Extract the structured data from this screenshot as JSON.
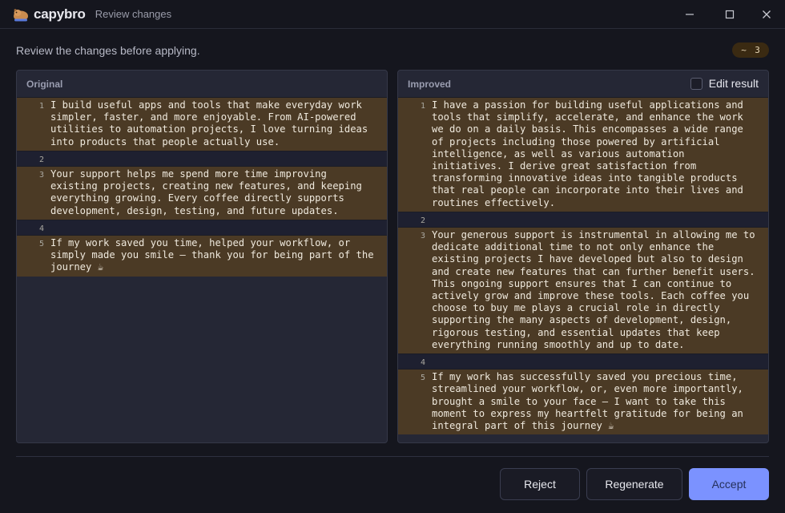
{
  "app": {
    "name": "capybro",
    "window_title": "Review changes",
    "logo_icon": "capybara-icon"
  },
  "subtitle": "Review the changes before applying.",
  "badge": {
    "symbol": "~",
    "count": "3"
  },
  "original": {
    "title": "Original",
    "lines": [
      {
        "num": "1",
        "text": "I build useful apps and tools that make everyday work simpler, faster, and more enjoyable. From AI-powered utilities to automation projects, I love turning ideas into products that people actually use.",
        "changed": true
      },
      {
        "num": "2",
        "text": "",
        "changed": false
      },
      {
        "num": "3",
        "text": "Your support helps me spend more time improving existing projects, creating new features, and keeping everything growing. Every coffee directly supports development, design, testing, and future updates.",
        "changed": true
      },
      {
        "num": "4",
        "text": "",
        "changed": false
      },
      {
        "num": "5",
        "text": "If my work saved you time, helped your workflow, or simply made you smile — thank you for being part of the journey ☕",
        "changed": true
      }
    ]
  },
  "improved": {
    "title": "Improved",
    "edit_label": "Edit result",
    "lines": [
      {
        "num": "1",
        "text": "I have a passion for building useful applications and tools that simplify, accelerate, and enhance the work we do on a daily basis. This encompasses a wide range of projects including those powered by artificial intelligence, as well as various automation initiatives. I derive great satisfaction from transforming innovative ideas into tangible products that real people can incorporate into their lives and routines effectively.",
        "changed": true
      },
      {
        "num": "2",
        "text": "",
        "changed": false
      },
      {
        "num": "3",
        "text": "Your generous support is instrumental in allowing me to dedicate additional time to not only enhance the existing projects I have developed but also to design and create new features that can further benefit users. This ongoing support ensures that I can continue to actively grow and improve these tools. Each coffee you choose to buy me plays a crucial role in directly supporting the many aspects of development, design, rigorous testing, and essential updates that keep everything running smoothly and up to date.",
        "changed": true
      },
      {
        "num": "4",
        "text": "",
        "changed": false
      },
      {
        "num": "5",
        "text": "If my work has successfully saved you precious time, streamlined your workflow, or, even more importantly, brought a smile to your face — I want to take this moment to express my heartfelt gratitude for being an integral part of this journey ☕",
        "changed": true
      }
    ]
  },
  "buttons": {
    "reject": "Reject",
    "regenerate": "Regenerate",
    "accept": "Accept"
  },
  "colors": {
    "accent": "#7b92ff",
    "changed_line": "#4b3a25",
    "panel_bg": "#252735",
    "window_bg": "#15161e"
  }
}
